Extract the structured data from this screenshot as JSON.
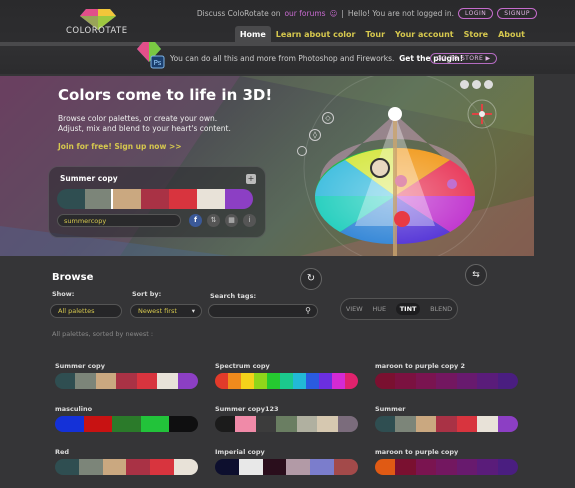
{
  "header": {
    "logo_text": "COLOROTATE",
    "discuss_prefix": "Discuss  ColoRotate  on",
    "forums_link": "our forums",
    "forums_icon": "people-icon",
    "separator": "|",
    "greeting": "Hello! You are not logged in.",
    "login": "LOGIN",
    "signup": "SIGNUP"
  },
  "nav": {
    "items": [
      "Home",
      "Learn about color",
      "Tour",
      "Your account",
      "Store",
      "About"
    ],
    "active": "Home"
  },
  "plugin": {
    "ps_badge": "Ps",
    "text": "You can do all this and more from Photoshop and Fireworks.",
    "bold": "Get the plugin!",
    "store_button": "GO TO STORE"
  },
  "hero": {
    "title": "Colors come to life in 3D!",
    "desc_1": "Browse color palettes, or create your own.",
    "desc_2": "Adjust, mix and blend to your heart's content.",
    "join": "Join for free! Sign up now >>"
  },
  "card": {
    "title": "Summer copy",
    "plus": "+",
    "name_value": "summercopy",
    "swatches": [
      "#2f4e51",
      "#7c8579",
      "#caa880",
      "#a93245",
      "#d8343e",
      "#e8e2d8",
      "#8c3fc4"
    ],
    "icons": [
      "facebook-icon",
      "share-icon",
      "grid-icon",
      "info-icon"
    ]
  },
  "controls": {
    "view_options": [
      "VIEW",
      "HUE",
      "TINT",
      "BLEND"
    ],
    "selected_view": "TINT"
  },
  "browse": {
    "title": "Browse",
    "show_label": "Show:",
    "show_value": "All palettes",
    "sort_label": "Sort by:",
    "sort_value": "Newest first",
    "search_label": "Search tags:",
    "search_value": "",
    "sorted_text": "All palettes, sorted by newest :"
  },
  "palettes": [
    {
      "name": "Summer copy",
      "colors": [
        "#2f4e51",
        "#7c8579",
        "#caa880",
        "#a93245",
        "#d8343e",
        "#e8e2d8",
        "#8c3fc4"
      ]
    },
    {
      "name": "Spectrum copy",
      "colors": [
        "#e23a2a",
        "#ef8a1c",
        "#f4d21a",
        "#8fd61a",
        "#25c930",
        "#1bc98d",
        "#22b9d6",
        "#2a5be0",
        "#6b2fe0",
        "#d42ad4",
        "#e0226d"
      ]
    },
    {
      "name": "maroon to purple copy 2",
      "colors": [
        "#7a1030",
        "#7b1140",
        "#7a1450",
        "#731760",
        "#681a6e",
        "#5a1c7a",
        "#4a1e80"
      ]
    },
    {
      "name": "masculino",
      "colors": [
        "#1431d8",
        "#c81212",
        "#2b7a2a",
        "#22c33a",
        "#0f0f10"
      ]
    },
    {
      "name": "Summer copy123",
      "colors": [
        "#1b1b1b",
        "#f08aa8",
        "#3c3c3c",
        "#6a7e62",
        "#b0b0a0",
        "#d6c8b0",
        "#7b6c7c"
      ]
    },
    {
      "name": "Summer",
      "colors": [
        "#2f4e51",
        "#7c8579",
        "#caa880",
        "#a93245",
        "#d8343e",
        "#e8e2d8",
        "#8c3fc4"
      ]
    },
    {
      "name": "Red",
      "colors": [
        "#2f4e51",
        "#7c8579",
        "#caa880",
        "#a93245",
        "#d8343e",
        "#e8e2d8"
      ]
    },
    {
      "name": "Imperial copy",
      "colors": [
        "#0d0f2e",
        "#e8e8e8",
        "#2a0e1c",
        "#b29aa6",
        "#7b7dcc",
        "#a34a4a"
      ]
    },
    {
      "name": "maroon to purple copy",
      "colors": [
        "#e05a14",
        "#7a1030",
        "#7a1450",
        "#731760",
        "#681a6e",
        "#5a1c7a",
        "#4a1e80"
      ]
    }
  ]
}
